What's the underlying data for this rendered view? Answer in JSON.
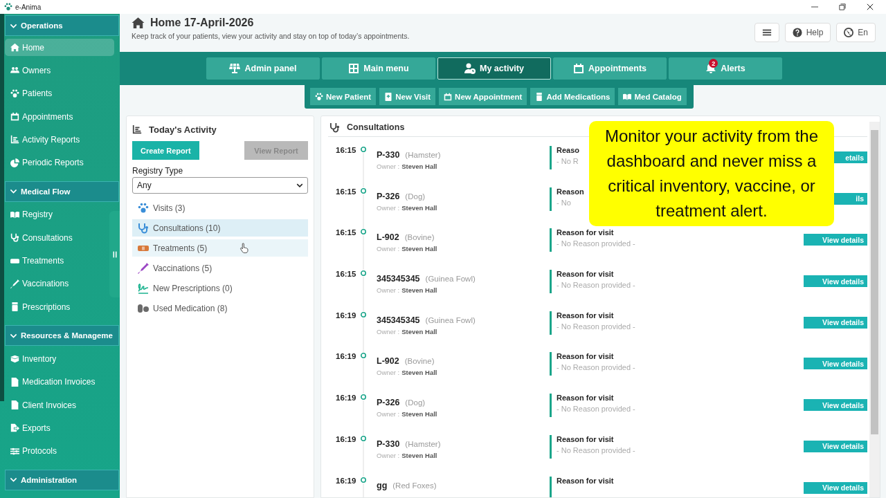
{
  "window": {
    "title": "e-Anima"
  },
  "sidebar": {
    "sections": [
      {
        "title": "Operations",
        "expanded": true,
        "items": [
          {
            "label": "Home",
            "selected": true
          },
          {
            "label": "Owners",
            "selected": false
          },
          {
            "label": "Patients",
            "selected": false
          },
          {
            "label": "Appointments",
            "selected": false
          },
          {
            "label": "Activity Reports",
            "selected": false
          },
          {
            "label": "Periodic Reports",
            "selected": false
          }
        ]
      },
      {
        "title": "Medical Flow",
        "expanded": true,
        "items": [
          {
            "label": "Registry",
            "selected": false
          },
          {
            "label": "Consultations",
            "selected": false
          },
          {
            "label": "Treatments",
            "selected": false
          },
          {
            "label": "Vaccinations",
            "selected": false
          },
          {
            "label": "Prescriptions",
            "selected": false
          }
        ]
      },
      {
        "title": "Resources & Manageme",
        "expanded": true,
        "items": [
          {
            "label": "Inventory",
            "selected": false
          },
          {
            "label": "Medication Invoices",
            "selected": false
          },
          {
            "label": "Client Invoices",
            "selected": false
          },
          {
            "label": "Exports",
            "selected": false
          },
          {
            "label": "Protocols",
            "selected": false
          }
        ]
      },
      {
        "title": "Administration",
        "expanded": true
      }
    ]
  },
  "header": {
    "title": "Home 17-April-2026",
    "subtitle": "Keep track of your patients, view your activity and stay on top of today’s appointments.",
    "help": "Help",
    "language": "En"
  },
  "nav_tabs": [
    {
      "label": "Admin panel",
      "selected": false
    },
    {
      "label": "Main menu",
      "selected": false
    },
    {
      "label": "My activity",
      "selected": true
    },
    {
      "label": "Appointments",
      "selected": false
    },
    {
      "label": "Alerts",
      "selected": false,
      "badge": "2"
    }
  ],
  "quick_actions": [
    {
      "label": "New Patient"
    },
    {
      "label": "New Visit"
    },
    {
      "label": "New Appointment"
    },
    {
      "label": "Add Medications"
    },
    {
      "label": "Med Catalog"
    }
  ],
  "activity": {
    "title": "Today's Activity",
    "create_button": "Create Report",
    "view_button": {
      "label": "View Report",
      "disabled": true
    },
    "registry_label": "Registry Type",
    "registry_value": "Any",
    "categories": [
      {
        "label": "Visits (3)",
        "selected": false,
        "hovered": false
      },
      {
        "label": "Consultations (10)",
        "selected": true,
        "hovered": false
      },
      {
        "label": "Treatments (5)",
        "selected": false,
        "hovered": true
      },
      {
        "label": "Vaccinations (5)",
        "selected": false,
        "hovered": false
      },
      {
        "label": "New Prescriptions (0)",
        "selected": false,
        "hovered": false
      },
      {
        "label": "Used Medication (8)",
        "selected": false,
        "hovered": false
      }
    ]
  },
  "consultations": {
    "title": "Consultations",
    "rows": [
      {
        "time": "16:15",
        "name": "P-330",
        "species": "(Hamster)",
        "owner_label": "Owner :",
        "owner": "Steven Hall",
        "reason_label": "Reaso",
        "reason": "- No R",
        "button": "etails"
      },
      {
        "time": "16:15",
        "name": "P-326",
        "species": "(Dog)",
        "owner_label": "Owner :",
        "owner": "Steven Hall",
        "reason_label": "Reason",
        "reason": "- No",
        "button": "ils"
      },
      {
        "time": "16:15",
        "name": "L-902",
        "species": "(Bovine)",
        "owner_label": "Owner :",
        "owner": "Steven Hall",
        "reason_label": "Reason for visit",
        "reason": "- No Reason provided -",
        "button": "View details"
      },
      {
        "time": "16:15",
        "name": "345345345",
        "species": "(Guinea Fowl)",
        "owner_label": "Owner :",
        "owner": "Steven Hall",
        "reason_label": "Reason for visit",
        "reason": "- No Reason provided -",
        "button": "View details"
      },
      {
        "time": "16:19",
        "name": "345345345",
        "species": "(Guinea Fowl)",
        "owner_label": "Owner :",
        "owner": "Steven Hall",
        "reason_label": "Reason for visit",
        "reason": "- No Reason provided -",
        "button": "View details"
      },
      {
        "time": "16:19",
        "name": "L-902",
        "species": "(Bovine)",
        "owner_label": "Owner :",
        "owner": "Steven Hall",
        "reason_label": "Reason for visit",
        "reason": "- No Reason provided -",
        "button": "View details"
      },
      {
        "time": "16:19",
        "name": "P-326",
        "species": "(Dog)",
        "owner_label": "Owner :",
        "owner": "Steven Hall",
        "reason_label": "Reason for visit",
        "reason": "- No Reason provided -",
        "button": "View details"
      },
      {
        "time": "16:19",
        "name": "P-330",
        "species": "(Hamster)",
        "owner_label": "Owner :",
        "owner": "Steven Hall",
        "reason_label": "Reason for visit",
        "reason": "- No Reason provided -",
        "button": "View details"
      },
      {
        "time": "16:19",
        "name": "gg",
        "species": "(Red Foxes)",
        "reason_label": "Reason for visit",
        "button": "View details"
      }
    ]
  },
  "caption": "Monitor your activity from the dashboard and never miss a critical inventory, vaccine, or treatment alert."
}
